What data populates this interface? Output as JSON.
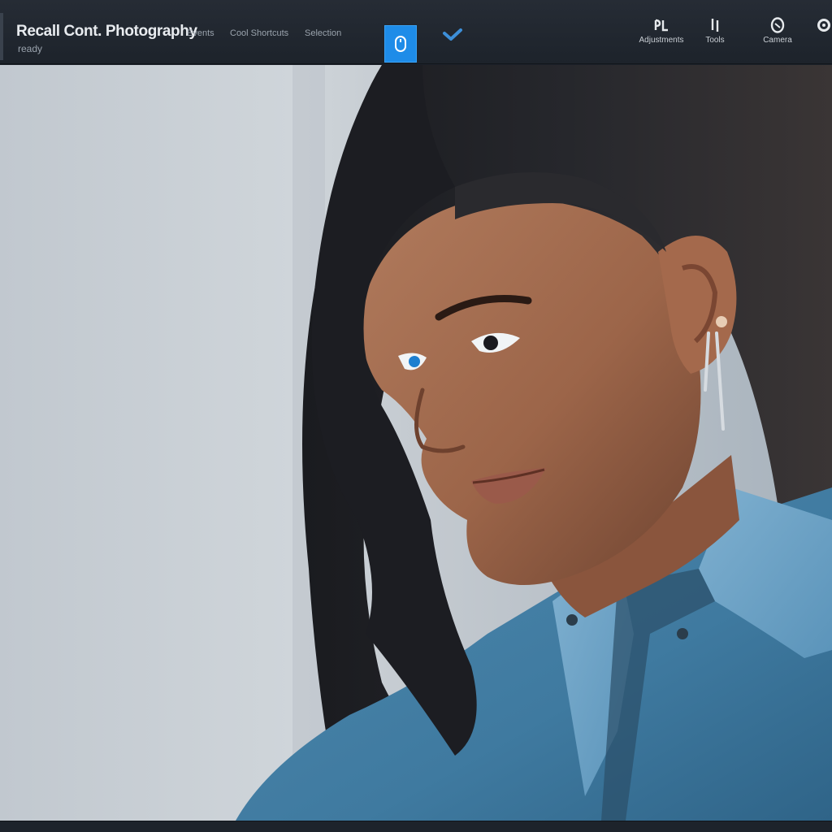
{
  "header": {
    "title": "Recall Cont. Photography",
    "subtitle": "ready"
  },
  "nav": {
    "items": [
      "Events",
      "Cool Shortcuts",
      "Selection"
    ]
  },
  "toolbar": {
    "primary_icon": "mouse-icon",
    "check_icon": "checkmark-icon",
    "tools": [
      {
        "icon": "brush-icon",
        "label": "Adjustments"
      },
      {
        "icon": "crop-icon",
        "label": "Tools"
      },
      {
        "icon": "face-icon",
        "label": "Camera"
      },
      {
        "icon": "gear-icon"
      }
    ]
  },
  "colors": {
    "accent": "#1e8ce8",
    "topbar": "#1d232b",
    "canvas_background": "#c7cdd3"
  }
}
